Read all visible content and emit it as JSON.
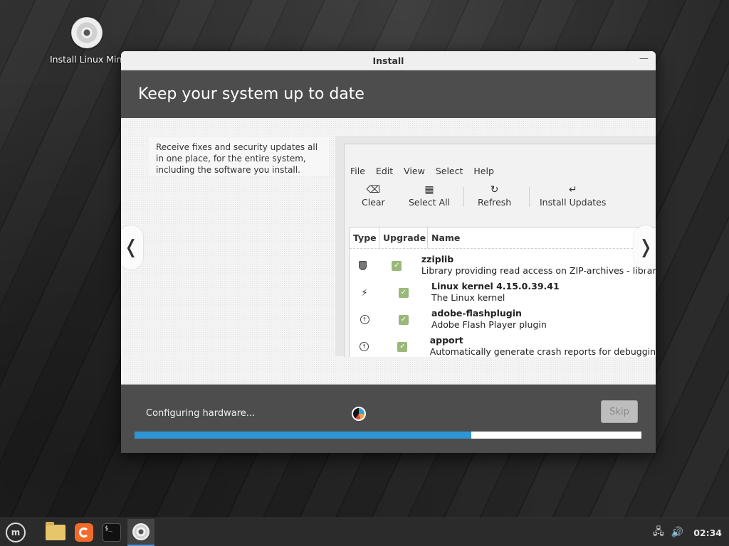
{
  "desktop": {
    "icons": [
      {
        "label": "Install Linux Mint",
        "icon": "disc-icon"
      }
    ]
  },
  "window": {
    "title": "Install",
    "minimize_glyph": "—",
    "header_title": "Keep your system up to date",
    "slide": {
      "description": "Receive fixes and security updates all in one place, for the entire system, including the software you install.",
      "prev_glyph": "❬",
      "next_glyph": "❭",
      "mock_app": {
        "menu": [
          "File",
          "Edit",
          "View",
          "Select",
          "Help"
        ],
        "toolbar": [
          {
            "label": "Clear",
            "icon": "⌫"
          },
          {
            "label": "Select All",
            "icon": "▦"
          },
          {
            "label": "Refresh",
            "icon": "↻"
          },
          {
            "label": "Install Updates",
            "icon": "↵"
          }
        ],
        "columns": [
          "Type",
          "Upgrade",
          "Name"
        ],
        "rows": [
          {
            "type_icon": "shield-icon",
            "name": "zziplib",
            "desc": "Library providing read access on ZIP-archives - library"
          },
          {
            "type_icon": "kernel-icon",
            "name": "Linux kernel 4.15.0.39.41",
            "desc": "The Linux kernel"
          },
          {
            "type_icon": "upgrade-icon",
            "name": "adobe-flashplugin",
            "desc": "Adobe Flash Player plugin"
          },
          {
            "type_icon": "upgrade-icon",
            "name": "apport",
            "desc": "Automatically generate crash reports for debugging"
          }
        ]
      }
    },
    "status": "Configuring hardware...",
    "skip_label": "Skip",
    "progress": 0.665
  },
  "taskbar": {
    "clock": "02:34",
    "apps": [
      "menu-icon",
      "files-icon",
      "firefox-icon",
      "terminal-icon",
      "installer-icon"
    ]
  }
}
